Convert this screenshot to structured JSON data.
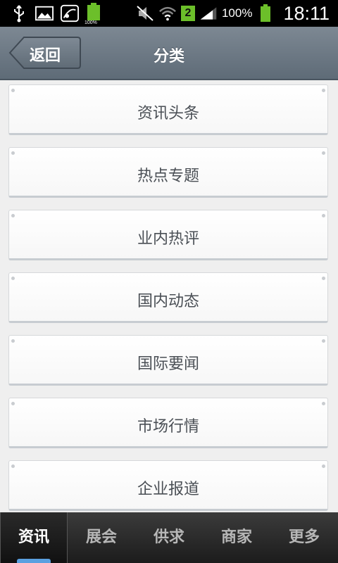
{
  "status_bar": {
    "battery_small_label": "100%",
    "sim_number": "2",
    "battery_percent": "100%",
    "time": "18:11"
  },
  "header": {
    "back_label": "返回",
    "title": "分类"
  },
  "categories": [
    {
      "label": "资讯头条"
    },
    {
      "label": "热点专题"
    },
    {
      "label": "业内热评"
    },
    {
      "label": "国内动态"
    },
    {
      "label": "国际要闻"
    },
    {
      "label": "市场行情"
    },
    {
      "label": "企业报道"
    }
  ],
  "tabs": [
    {
      "label": "资讯",
      "active": true
    },
    {
      "label": "展会",
      "active": false
    },
    {
      "label": "供求",
      "active": false
    },
    {
      "label": "商家",
      "active": false
    },
    {
      "label": "更多",
      "active": false
    }
  ],
  "colors": {
    "header_bg": "#6d7984",
    "tab_bar_bg": "#2a2a2a",
    "tab_indicator": "#5aa0e0",
    "battery_green": "#6cbf2a"
  },
  "icons": {
    "status_left": [
      "usb-icon",
      "image-icon",
      "signal-off-icon",
      "battery-icon"
    ],
    "status_right": [
      "mute-icon",
      "wifi-icon",
      "sim-icon",
      "cell-signal-icon",
      "battery-icon"
    ]
  }
}
